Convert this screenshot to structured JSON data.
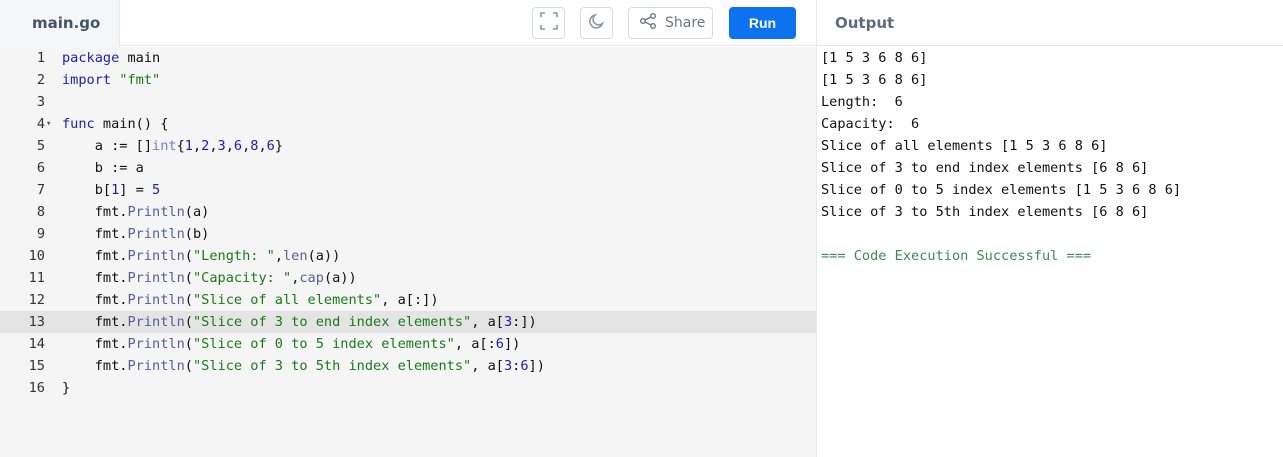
{
  "header": {
    "file_tab": "main.go",
    "share_label": "Share",
    "run_label": "Run",
    "output_title": "Output",
    "icons": {
      "fullscreen": "fullscreen-icon",
      "theme": "moon-icon",
      "share": "share-icon"
    }
  },
  "editor": {
    "language": "go",
    "active_line": 13,
    "lines": [
      {
        "n": "1",
        "text": "package main"
      },
      {
        "n": "2",
        "text": "import \"fmt\""
      },
      {
        "n": "3",
        "text": ""
      },
      {
        "n": "4",
        "text": "func main() {"
      },
      {
        "n": "5",
        "text": "    a := []int{1,2,3,6,8,6}"
      },
      {
        "n": "6",
        "text": "    b := a"
      },
      {
        "n": "7",
        "text": "    b[1] = 5"
      },
      {
        "n": "8",
        "text": "    fmt.Println(a)"
      },
      {
        "n": "9",
        "text": "    fmt.Println(b)"
      },
      {
        "n": "10",
        "text": "    fmt.Println(\"Length: \",len(a))"
      },
      {
        "n": "11",
        "text": "    fmt.Println(\"Capacity: \",cap(a))"
      },
      {
        "n": "12",
        "text": "    fmt.Println(\"Slice of all elements\", a[:])"
      },
      {
        "n": "13",
        "text": "    fmt.Println(\"Slice of 3 to end index elements\", a[3:])"
      },
      {
        "n": "14",
        "text": "    fmt.Println(\"Slice of 0 to 5 index elements\", a[:6])"
      },
      {
        "n": "15",
        "text": "    fmt.Println(\"Slice of 3 to 5th index elements\", a[3:6])"
      },
      {
        "n": "16",
        "text": "}"
      }
    ]
  },
  "output": {
    "lines": [
      "[1 5 3 6 8 6]",
      "[1 5 3 6 8 6]",
      "Length:  6",
      "Capacity:  6",
      "Slice of all elements [1 5 3 6 8 6]",
      "Slice of 3 to end index elements [6 8 6]",
      "Slice of 0 to 5 index elements [1 5 3 6 8 6]",
      "Slice of 3 to 5th index elements [6 8 6]",
      "",
      "=== Code Execution Successful ==="
    ]
  },
  "colors": {
    "run_button": "#0c72f0",
    "success_text": "#3c8a5a",
    "active_line": "#e4e4e4"
  }
}
